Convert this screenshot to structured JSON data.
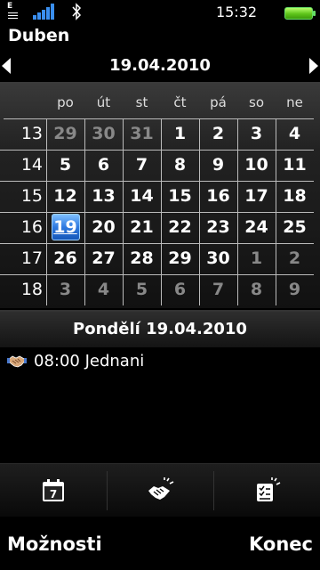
{
  "status": {
    "network_type": "E",
    "time": "15:32",
    "signal_level": 1.0,
    "battery_level": 1.0,
    "icons": [
      "edge-signal-icon",
      "signal-strength-icon",
      "bluetooth-icon",
      "battery-icon"
    ]
  },
  "header": {
    "month": "Duben",
    "date": "19.04.2010"
  },
  "calendar": {
    "weekdays": [
      "po",
      "út",
      "st",
      "čt",
      "pá",
      "so",
      "ne"
    ],
    "weeks": [
      {
        "number": "13",
        "days": [
          {
            "d": "29",
            "other": true
          },
          {
            "d": "30",
            "other": true
          },
          {
            "d": "31",
            "other": true
          },
          {
            "d": "1"
          },
          {
            "d": "2"
          },
          {
            "d": "3"
          },
          {
            "d": "4"
          }
        ]
      },
      {
        "number": "14",
        "days": [
          {
            "d": "5"
          },
          {
            "d": "6"
          },
          {
            "d": "7"
          },
          {
            "d": "8"
          },
          {
            "d": "9"
          },
          {
            "d": "10"
          },
          {
            "d": "11"
          }
        ]
      },
      {
        "number": "15",
        "days": [
          {
            "d": "12"
          },
          {
            "d": "13"
          },
          {
            "d": "14"
          },
          {
            "d": "15"
          },
          {
            "d": "16"
          },
          {
            "d": "17"
          },
          {
            "d": "18"
          }
        ]
      },
      {
        "number": "16",
        "days": [
          {
            "d": "19",
            "selected": true
          },
          {
            "d": "20"
          },
          {
            "d": "21"
          },
          {
            "d": "22"
          },
          {
            "d": "23"
          },
          {
            "d": "24"
          },
          {
            "d": "25"
          }
        ]
      },
      {
        "number": "17",
        "days": [
          {
            "d": "26"
          },
          {
            "d": "27"
          },
          {
            "d": "28"
          },
          {
            "d": "29"
          },
          {
            "d": "30"
          },
          {
            "d": "1",
            "other": true
          },
          {
            "d": "2",
            "other": true
          }
        ]
      },
      {
        "number": "18",
        "days": [
          {
            "d": "3",
            "other": true
          },
          {
            "d": "4",
            "other": true
          },
          {
            "d": "5",
            "other": true
          },
          {
            "d": "6",
            "other": true
          },
          {
            "d": "7",
            "other": true
          },
          {
            "d": "8",
            "other": true
          },
          {
            "d": "9",
            "other": true
          }
        ]
      }
    ]
  },
  "day_view": {
    "title": "Pondělí 19.04.2010",
    "events": [
      {
        "icon": "meeting-handshake-icon",
        "text": "08:00 Jednani"
      }
    ]
  },
  "toolbar": {
    "items": [
      {
        "icon": "calendar-day-icon",
        "day": "7"
      },
      {
        "icon": "new-meeting-icon"
      },
      {
        "icon": "new-todo-icon"
      }
    ]
  },
  "softkeys": {
    "left": "Možnosti",
    "right": "Konec"
  },
  "colors": {
    "selection": "#2f7ae0",
    "signal": "#3a8ff0",
    "battery": "#5ec41a"
  }
}
